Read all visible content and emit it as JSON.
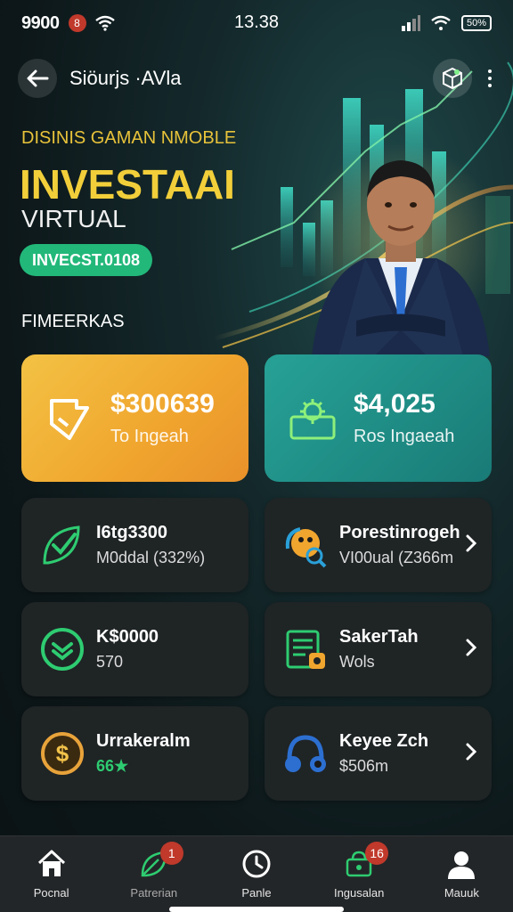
{
  "status_bar": {
    "left_time": "9900",
    "notification_count": "8",
    "center_time": "13.38",
    "battery_label": "50%"
  },
  "header": {
    "title": "Siöurjs ·AVla"
  },
  "hero": {
    "subtitle": "DISINIS GAMAN NMOBLE",
    "title": "INVESTAAI",
    "title2": "VIRTUAL",
    "badge": "INVECST.0108"
  },
  "section_label": "FIMEERKAS",
  "stat_cards": [
    {
      "value": "$300639",
      "sub": "To Ingeah",
      "icon": "shield-check-icon"
    },
    {
      "value": "$4,025",
      "sub": "Ros Ingaeah",
      "icon": "gear-box-icon"
    }
  ],
  "tiles": [
    {
      "title": "I6tg3300",
      "sub": "M0ddal (332%)",
      "icon": "check-leaf-icon",
      "chevron": false
    },
    {
      "title": "Porestinrogeh",
      "sub": "VI00ual (Z366m",
      "icon": "magnifier-character-icon",
      "chevron": true
    },
    {
      "title": "K$0000",
      "sub": "570",
      "icon": "dollar-circle-icon",
      "chevron": false
    },
    {
      "title": "SakerTah",
      "sub": "Wols",
      "icon": "document-icon",
      "chevron": true
    },
    {
      "title": "Urrakeralm",
      "sub": "66★",
      "icon": "coin-icon",
      "chevron": false
    },
    {
      "title": "Keyee Zch",
      "sub": "$506m",
      "icon": "headphones-icon",
      "chevron": true
    }
  ],
  "bottom_nav": [
    {
      "label": "Pocnal",
      "icon": "home-icon",
      "badge": ""
    },
    {
      "label": "Patrerian",
      "icon": "leaf-icon",
      "badge": "1"
    },
    {
      "label": "Panle",
      "icon": "clock-icon",
      "badge": ""
    },
    {
      "label": "Ingusalan",
      "icon": "cart-icon",
      "badge": "16"
    },
    {
      "label": "Mauuk",
      "icon": "user-icon",
      "badge": ""
    }
  ],
  "colors": {
    "gold_card": "#f0a52e",
    "teal_card": "#1e8b83",
    "badge_green": "#22b87a",
    "hero_yellow": "#f2cf3a",
    "accent_green": "#2ecc71"
  }
}
